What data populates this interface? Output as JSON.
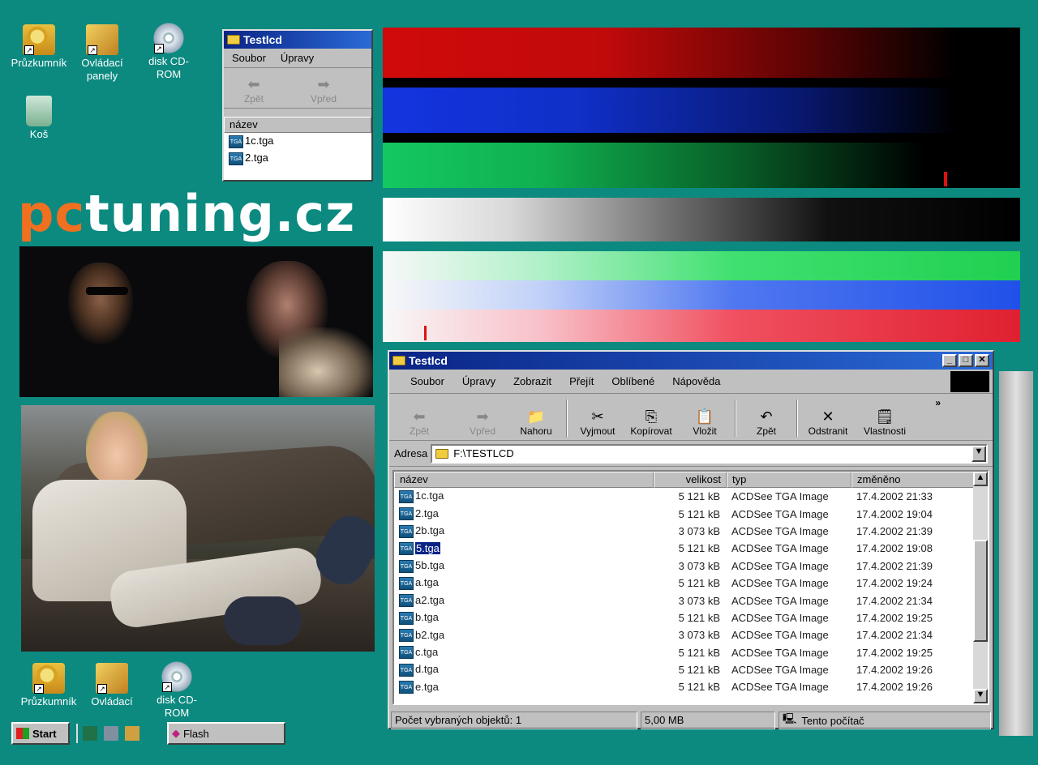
{
  "desktop_icons_top": [
    {
      "label": "Průzkumník",
      "icon": "explorer-icon"
    },
    {
      "label": "Ovládací panely",
      "icon": "control-panel-icon"
    },
    {
      "label": "disk CD-ROM",
      "icon": "cd-rom-icon"
    },
    {
      "label": "Koš",
      "icon": "recycle-bin-icon"
    }
  ],
  "desktop_icons_bottom": [
    {
      "label": "Průzkumník",
      "icon": "explorer-icon"
    },
    {
      "label": "Ovládací",
      "icon": "control-panel-icon"
    },
    {
      "label": "disk CD-ROM",
      "icon": "cd-rom-icon"
    }
  ],
  "logo": {
    "part1": "pc",
    "part2": "tuning.cz",
    "color1": "#f07020",
    "color2": "#ffffff"
  },
  "small_window": {
    "title": "Testlcd",
    "menu": [
      "Soubor",
      "Úpravy"
    ],
    "back": "Zpět",
    "forward": "Vpřed",
    "column": "název",
    "files": [
      "1c.tga",
      "2.tga"
    ]
  },
  "main_window": {
    "title": "Testlcd",
    "menu": [
      "Soubor",
      "Úpravy",
      "Zobrazit",
      "Přejít",
      "Oblíbené",
      "Nápověda"
    ],
    "toolbar": {
      "back": "Zpět",
      "forward": "Vpřed",
      "up": "Nahoru",
      "cut": "Vyjmout",
      "copy": "Kopírovat",
      "paste": "Vložit",
      "undo": "Zpět",
      "delete": "Odstranit",
      "properties": "Vlastnosti",
      "more": "»"
    },
    "address_label": "Adresa",
    "address_value": "F:\\TESTLCD",
    "columns": {
      "name": "název",
      "size": "velikost",
      "type": "typ",
      "modified": "změněno"
    },
    "files": [
      {
        "name": "1c.tga",
        "size": "5 121 kB",
        "type": "ACDSee TGA Image",
        "modified": "17.4.2002 21:33"
      },
      {
        "name": "2.tga",
        "size": "5 121 kB",
        "type": "ACDSee TGA Image",
        "modified": "17.4.2002 19:04"
      },
      {
        "name": "2b.tga",
        "size": "3 073 kB",
        "type": "ACDSee TGA Image",
        "modified": "17.4.2002 21:39"
      },
      {
        "name": "5.tga",
        "size": "5 121 kB",
        "type": "ACDSee TGA Image",
        "modified": "17.4.2002 19:08",
        "selected": true
      },
      {
        "name": "5b.tga",
        "size": "3 073 kB",
        "type": "ACDSee TGA Image",
        "modified": "17.4.2002 21:39"
      },
      {
        "name": "a.tga",
        "size": "5 121 kB",
        "type": "ACDSee TGA Image",
        "modified": "17.4.2002 19:24"
      },
      {
        "name": "a2.tga",
        "size": "3 073 kB",
        "type": "ACDSee TGA Image",
        "modified": "17.4.2002 21:34"
      },
      {
        "name": "b.tga",
        "size": "5 121 kB",
        "type": "ACDSee TGA Image",
        "modified": "17.4.2002 19:25"
      },
      {
        "name": "b2.tga",
        "size": "3 073 kB",
        "type": "ACDSee TGA Image",
        "modified": "17.4.2002 21:34"
      },
      {
        "name": "c.tga",
        "size": "5 121 kB",
        "type": "ACDSee TGA Image",
        "modified": "17.4.2002 19:25"
      },
      {
        "name": "d.tga",
        "size": "5 121 kB",
        "type": "ACDSee TGA Image",
        "modified": "17.4.2002 19:26"
      },
      {
        "name": "e.tga",
        "size": "5 121 kB",
        "type": "ACDSee TGA Image",
        "modified": "17.4.2002 19:26"
      }
    ],
    "status": {
      "selected": "Počet vybraných objektů: 1",
      "size": "5,00 MB",
      "location": "Tento počítač"
    }
  },
  "taskbar": {
    "start": "Start",
    "flash": "Flash"
  },
  "colors": {
    "desktop": "#0c8a80",
    "title_active": "#0a2486",
    "red": "#d01010",
    "blue": "#1030d8",
    "green": "#10c050"
  }
}
